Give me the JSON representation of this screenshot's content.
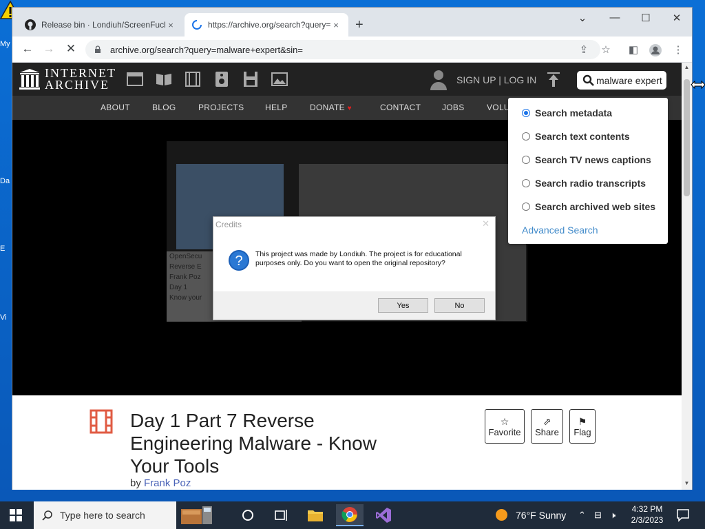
{
  "desktop": {
    "icon_labels": [
      "My",
      "Da",
      "E",
      "Vi"
    ]
  },
  "browser": {
    "tabs": [
      {
        "title": "Release bin · Londiuh/ScreenFuck",
        "close": "×"
      },
      {
        "title": "https://archive.org/search?query=",
        "close": "×"
      }
    ],
    "new_tab": "+",
    "url": "archive.org/search?query=malware+expert&sin="
  },
  "ia": {
    "logo_line1": "INTERNET",
    "logo_line2": "ARCHIVE",
    "signup": "SIGN UP | LOG IN",
    "search_value": "malware expert",
    "nav": [
      "ABOUT",
      "BLOG",
      "PROJECTS",
      "HELP",
      "DONATE",
      "CONTACT",
      "JOBS",
      "VOLU"
    ],
    "search_options": [
      {
        "label": "Search metadata",
        "selected": true
      },
      {
        "label": "Search text contents",
        "selected": false
      },
      {
        "label": "Search TV news captions",
        "selected": false
      },
      {
        "label": "Search radio transcripts",
        "selected": false
      },
      {
        "label": "Search archived web sites",
        "selected": false
      }
    ],
    "advanced_search": "Advanced Search",
    "video_text": [
      "OpenSecu",
      "Reverse E",
      "Frank Poz",
      "Day 1",
      "Know your"
    ],
    "item_title": "Day 1 Part 7 Reverse Engineering Malware - Know Your Tools",
    "by_label": "by",
    "author": "Frank Poz",
    "actions": [
      {
        "label": "Favorite",
        "icon": "star-icon"
      },
      {
        "label": "Share",
        "icon": "share-icon"
      },
      {
        "label": "Flag",
        "icon": "flag-icon"
      }
    ]
  },
  "dialog": {
    "title": "Credits",
    "message": "This project was made by Londiuh. The project is for educational purposes only. Do you want to open the original repository?",
    "yes": "Yes",
    "no": "No"
  },
  "taskbar": {
    "search_placeholder": "Type here to search",
    "weather": "76°F  Sunny",
    "time": "4:32 PM",
    "date": "2/3/2023"
  }
}
